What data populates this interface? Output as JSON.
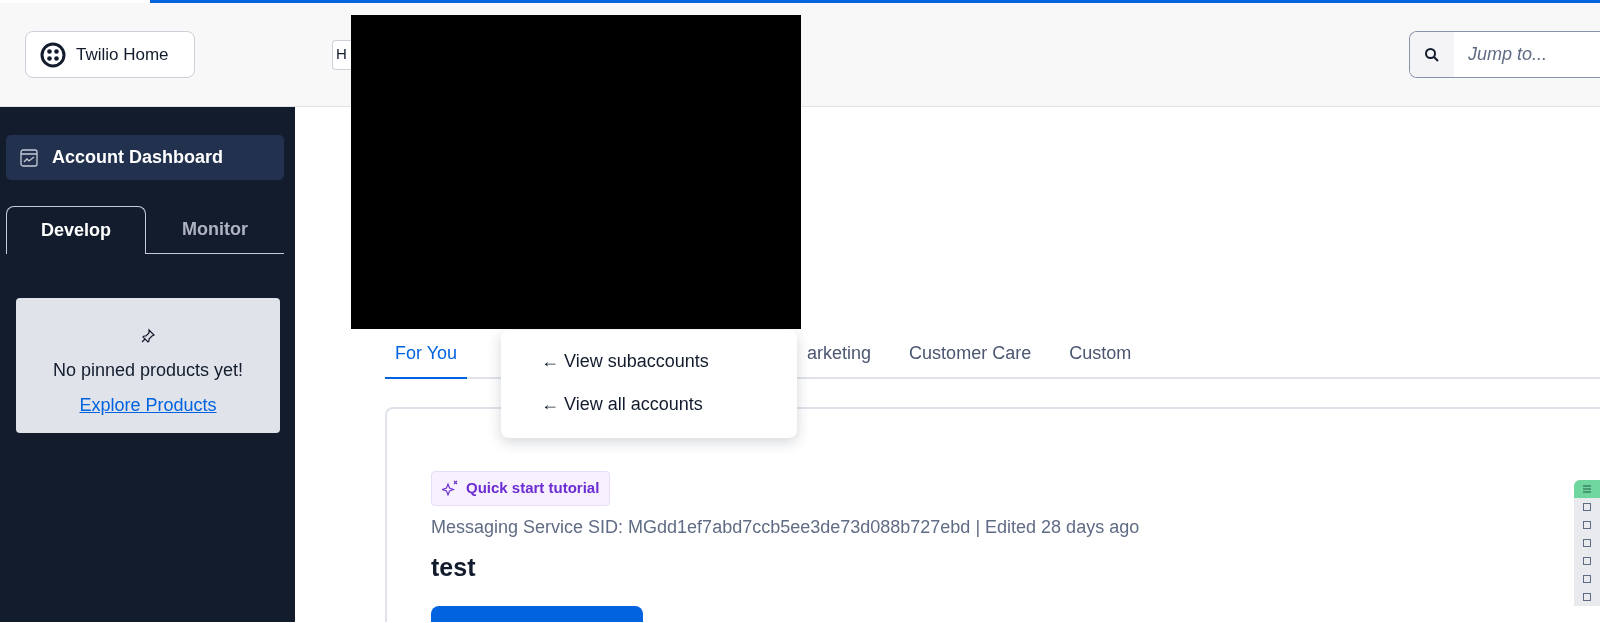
{
  "header": {
    "home_button": "Twilio Home",
    "account_button": "H",
    "search": {
      "placeholder": "Jump to..."
    }
  },
  "sidebar": {
    "dashboard": {
      "label": "Account Dashboard",
      "selected": true
    },
    "tabs": [
      {
        "label": "Develop",
        "selected": true
      },
      {
        "label": "Monitor",
        "selected": false
      }
    ],
    "pinned": {
      "message": "No pinned products yet!",
      "link": "Explore Products"
    }
  },
  "main": {
    "tabs": [
      {
        "label": "For You",
        "selected": true
      },
      {
        "label": "arketing",
        "selected": false
      },
      {
        "label": "Customer Care",
        "selected": false
      },
      {
        "label": "Custom",
        "selected": false
      }
    ],
    "card": {
      "badge": "Quick start tutorial",
      "meta": "Messaging Service SID: MGdd1ef7abd7ccb5ee3de73d088b727ebd | Edited 28 days ago",
      "title": "test"
    }
  },
  "menu": {
    "items": [
      {
        "label": "← View subaccounts"
      },
      {
        "label": "← View all accounts"
      }
    ]
  },
  "side_toolbar": {
    "items": [
      {
        "selected": true
      },
      {
        "selected": false
      },
      {
        "selected": false
      },
      {
        "selected": false
      },
      {
        "selected": false
      },
      {
        "selected": false
      },
      {
        "selected": false
      }
    ]
  }
}
